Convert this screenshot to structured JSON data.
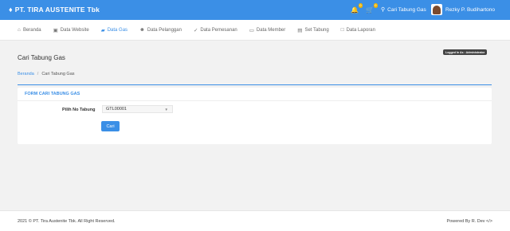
{
  "header": {
    "brand": "PT. TIRA AUSTENITE Tbk",
    "brand_icon": "flame-icon",
    "notifications_count": "0",
    "cart_count": "0",
    "search_link": "Cari Tabung Gas",
    "user_name": "Rezky P. Budihartono",
    "bg_color": "#3b8fe6"
  },
  "nav": {
    "items": [
      {
        "label": "Beranda",
        "icon": "home-icon"
      },
      {
        "label": "Data Website",
        "icon": "image-icon"
      },
      {
        "label": "Data Gas",
        "icon": "gas-icon",
        "active": true
      },
      {
        "label": "Data Pelanggan",
        "icon": "users-icon"
      },
      {
        "label": "Data Pemesanan",
        "icon": "cart-icon"
      },
      {
        "label": "Data Member",
        "icon": "card-icon"
      },
      {
        "label": "Set Tabung",
        "icon": "calendar-icon"
      },
      {
        "label": "Data Laporan",
        "icon": "file-icon"
      }
    ]
  },
  "login_badge": "Logged In As : Administrator",
  "page": {
    "title": "Cari Tabung Gas",
    "breadcrumb": [
      "Beranda",
      "Cari Tabung Gas"
    ]
  },
  "form": {
    "title": "FORM CARI TABUNG GAS",
    "label": "Pilih No Tabung",
    "selected": "GTL00001",
    "button": "Cari"
  },
  "footer": {
    "copyright": "2021 © PT. Tira Austenite Tbk. All Right Reserved.",
    "powered": "Powered By R. Dev </>"
  }
}
